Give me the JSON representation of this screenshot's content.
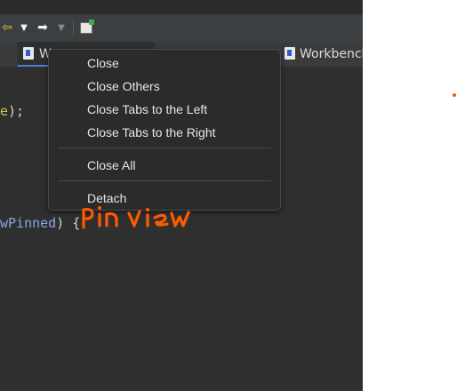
{
  "toolbar": {
    "icons": [
      "arrow-left-icon",
      "dropdown-arrow-icon",
      "arrow-right-icon",
      "dropdown-arrow-icon",
      "new-window-icon"
    ]
  },
  "tabs": [
    {
      "label": "W",
      "icon": "java-file-icon",
      "active": true
    },
    {
      "label": "Workbench",
      "icon": "java-file-icon",
      "active": false
    }
  ],
  "editor": {
    "line1_token": "e",
    "line1_rest": ");",
    "line2_token": "wPinned",
    "line2_rest": ") {"
  },
  "context_menu": {
    "close": "Close",
    "close_others": "Close Others",
    "close_left": "Close Tabs to the Left",
    "close_right": "Close Tabs to the Right",
    "close_all": "Close All",
    "detach": "Detach"
  },
  "annotation": {
    "text": "Pin view",
    "color": "#ff5a00"
  },
  "colors": {
    "editor_bg": "#2f2f2f",
    "menu_bg": "#2b2b2b",
    "accent": "#4b7fd1"
  }
}
